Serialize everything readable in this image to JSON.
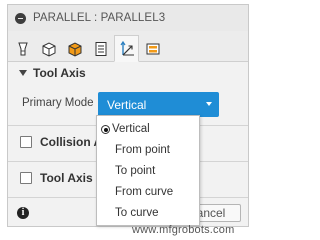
{
  "panel": {
    "title": "PARALLEL : PARALLEL3",
    "tabs": [
      {
        "icon": "tool-icon",
        "active": false
      },
      {
        "icon": "cube-outline-icon",
        "active": false
      },
      {
        "icon": "cube-orange-icon",
        "active": false
      },
      {
        "icon": "list-document-icon",
        "active": false
      },
      {
        "icon": "axis-arrows-icon",
        "active": true
      },
      {
        "icon": "linking-grid-icon",
        "active": false
      }
    ]
  },
  "tool_axis": {
    "header": "Tool Axis",
    "primary_mode_label": "Primary Mode",
    "primary_mode_value": "Vertical"
  },
  "collision": {
    "label": "Collision Av"
  },
  "tool_axis_limits": {
    "label": "Tool Axis L"
  },
  "footer": {
    "cancel_label": "ancel",
    "info_glyph": "i"
  },
  "dropdown": {
    "options": [
      "Vertical",
      "From point",
      "To point",
      "From curve",
      "To curve"
    ],
    "selected": "Vertical"
  },
  "watermark": "www.mfgrobots.com",
  "colors": {
    "accent": "#1f8dd6",
    "orange": "#f29a17"
  }
}
